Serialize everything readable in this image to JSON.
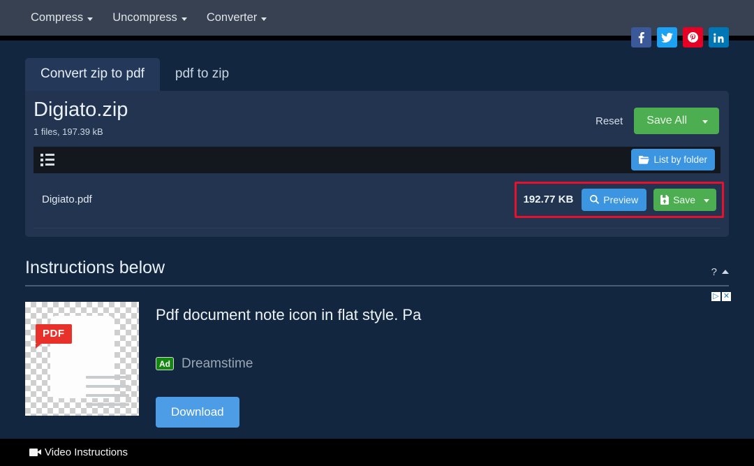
{
  "navbar": {
    "items": [
      {
        "label": "Compress",
        "icon": "chevron-down-icon"
      },
      {
        "label": "Uncompress",
        "icon": "chevron-down-icon"
      },
      {
        "label": "Converter",
        "icon": "chevron-down-icon"
      }
    ]
  },
  "social": [
    {
      "name": "facebook",
      "glyph": "f",
      "color": "#3b5998"
    },
    {
      "name": "twitter",
      "glyph": "t",
      "color": "#1da1f2"
    },
    {
      "name": "pinterest",
      "glyph": "P",
      "color": "#e60023"
    },
    {
      "name": "linkedin",
      "glyph": "in",
      "color": "#0077b5"
    }
  ],
  "tabs": [
    {
      "label": "Convert zip to pdf",
      "active": true
    },
    {
      "label": "pdf to zip",
      "active": false
    }
  ],
  "file": {
    "name": "Digiato.zip",
    "meta": "1 files, 197.39 kB",
    "reset_label": "Reset",
    "save_all_label": "Save All"
  },
  "toolbar": {
    "list_icon": "list-icon",
    "folder_button_label": "List by folder",
    "folder_icon": "folder-icon"
  },
  "rows": [
    {
      "name": "Digiato.pdf",
      "size": "192.77 KB",
      "preview_label": "Preview",
      "preview_icon": "search-icon",
      "save_label": "Save",
      "save_icon": "save-icon"
    }
  ],
  "instructions": {
    "title": "Instructions below",
    "help_glyph": "?",
    "collapse_icon": "chevron-up-icon"
  },
  "ad": {
    "thumb_alt": "pdf-document-icon",
    "thumb_badge": "PDF",
    "title": "Pdf document note icon in flat style. Pa",
    "badge": "Ad",
    "advertiser": "Dreamstime",
    "cta": "Download",
    "adchoices_icon": "adchoices-icon",
    "close_icon": "close-icon",
    "adchoices_glyph": "▷",
    "close_glyph": "✕"
  },
  "video": {
    "label": "Video Instructions",
    "icon": "video-camera-icon"
  },
  "colors": {
    "page_bg": "#12263f",
    "navbar_bg": "#374151",
    "card_bg": "#22344f",
    "tab_active_bg": "#24385a",
    "green": "#4cae50",
    "blue": "#3c95e0",
    "highlight_red": "#e8112d",
    "toolbar_bg": "#13171e",
    "video_bg": "#000000"
  }
}
